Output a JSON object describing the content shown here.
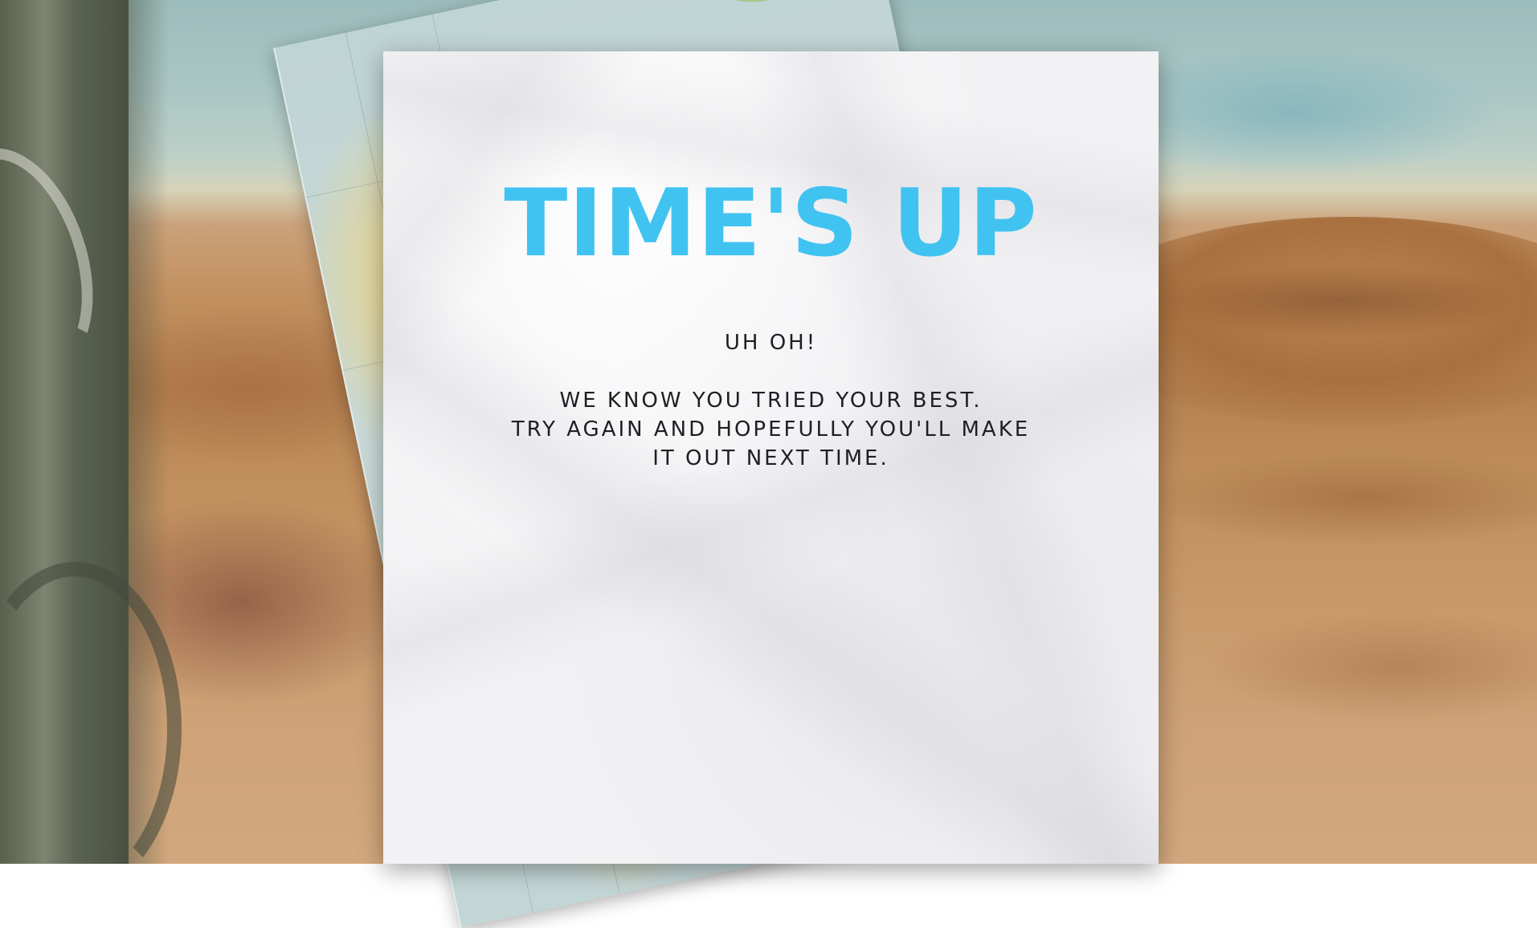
{
  "screen": {
    "title": "TIME'S UP",
    "subtitle": "UH OH!",
    "message_lines": [
      "WE KNOW YOU TRIED YOUR BEST.",
      "TRY AGAIN AND HOPEFULLY YOU'LL MAKE",
      "IT OUT NEXT TIME."
    ]
  },
  "colors": {
    "title": "#41c3f1",
    "text": "#1e1f22",
    "paper": "#f2f1f3"
  }
}
